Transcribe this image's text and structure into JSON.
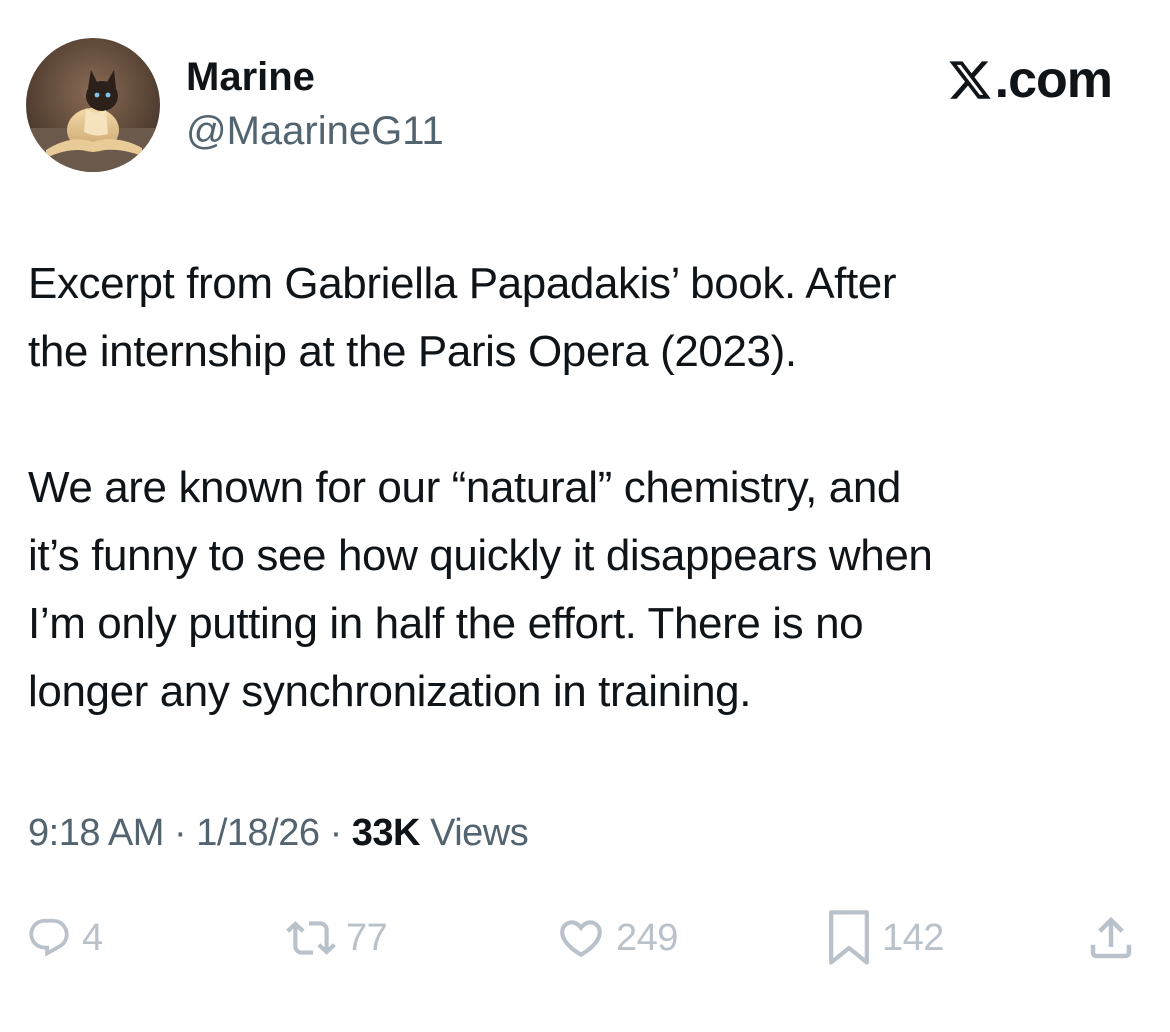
{
  "author": {
    "display_name": "Marine",
    "handle": "@MaarineG11",
    "avatar": "cat-photo-avatar"
  },
  "brand": {
    "text": ".com",
    "icon": "x-logo-icon"
  },
  "tweet": {
    "paragraph_1": {
      "line_1": "Excerpt from Gabriella Papadakis’ book. After",
      "line_2": "the internship at the Paris Opera (2023)."
    },
    "paragraph_2": {
      "line_1": "We are known for our “natural” chemistry, and",
      "line_2": "it’s funny to see how quickly it disappears when",
      "line_3": "I’m only putting in half the effort. There is no",
      "line_4": "longer any synchronization in training."
    }
  },
  "meta": {
    "time": "9:18 AM",
    "separator": "·",
    "date": "1/18/26",
    "views_count": "33K",
    "views_label": "Views"
  },
  "actions": {
    "reply": {
      "icon": "reply-icon",
      "count": "4"
    },
    "repost": {
      "icon": "repost-icon",
      "count": "77"
    },
    "like": {
      "icon": "heart-icon",
      "count": "249"
    },
    "bookmark": {
      "icon": "bookmark-icon",
      "count": "142"
    },
    "share": {
      "icon": "share-icon"
    }
  },
  "colors": {
    "text_primary": "#0f1419",
    "text_secondary": "#536471",
    "action_gray": "#b9c2cb",
    "background": "#ffffff"
  }
}
